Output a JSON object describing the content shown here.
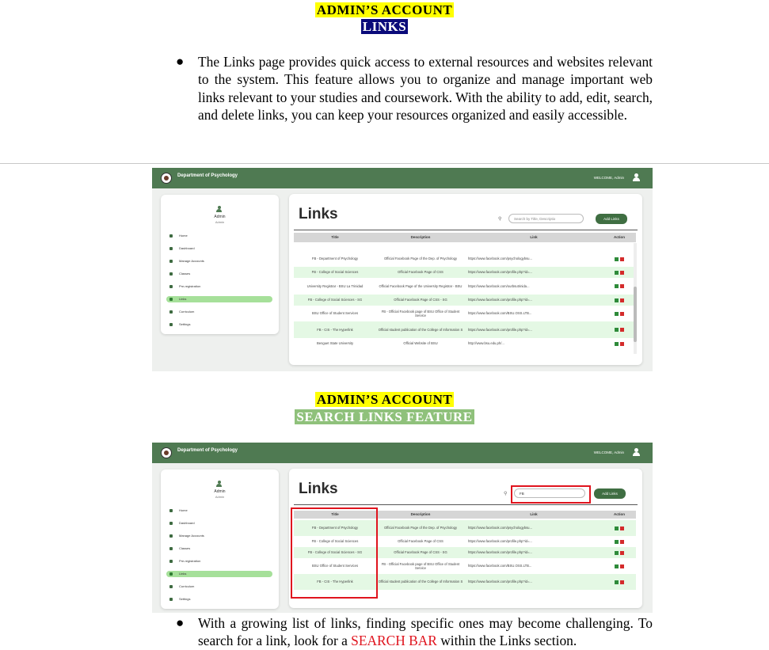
{
  "section1": {
    "heading1": "ADMIN’S ACCOUNT",
    "heading2": "LINKS",
    "bullet": "●",
    "paragraph": "The Links page provides quick access to external resources and websites relevant to the system. This feature allows you to organize and manage important web links relevant to your studies and coursework. With the ability to add, edit, search, and delete links, you can keep your resources organized and easily accessible."
  },
  "section2": {
    "heading1": "ADMIN’S ACCOUNT",
    "heading2": "SEARCH LINKS FEATURE",
    "bullet": "●",
    "paragraph_before": "With a growing list of links, finding specific ones may become challenging. To search for a link, look for a ",
    "paragraph_highlight": "SEARCH BAR",
    "paragraph_after": " within the Links section."
  },
  "app": {
    "department": "Department of Psychology",
    "welcome": "WELCOME, Admin",
    "user_name": "Admin",
    "user_role": "Admin",
    "nav": [
      "Home",
      "Dashboard",
      "Manage Accounts",
      "Classes",
      "Pre-registration",
      "Links",
      "Curriculum",
      "Settings"
    ],
    "page_title": "Links",
    "search_placeholder": "Search by Title, Descriptio",
    "search_value": "FB",
    "add_button": "Add Links",
    "columns": [
      "Title",
      "Description",
      "Link",
      "Action"
    ],
    "accent_color": "#4f7a52",
    "highlight_row_color": "#e4f8e4",
    "rows_full": [
      {
        "title": "FB - Department of Psychology",
        "description": "Official Facebook Page of the Dep. of Psychology",
        "link": "https://www.facebook.com/psychologybsu..."
      },
      {
        "title": "FB - College of Social Sciences",
        "description": "Official Facebook Page of CSS",
        "link": "https://www.facebook.com/profile.php?id=..."
      },
      {
        "title": "University Registrar - BSU La Trinidad",
        "description": "Official Facebook Page of the University Registrar - BSU",
        "link": "https://www.facebook.com/ourbsutrinida..."
      },
      {
        "title": "FB - College of Social Sciences - SG",
        "description": "Official Facebook Page of CSS - SG",
        "link": "https://www.facebook.com/profile.php?id=..."
      },
      {
        "title": "BSU Office of Student Services",
        "description": "FB - Official Facebook page of BSU Office of Student Service",
        "link": "https://www.facebook.com/BSU.OSS.LTB..."
      },
      {
        "title": "FB - CIS - The Hyperlink",
        "description": "Official student publication of the College of Information S",
        "link": "https://www.facebook.com/profile.php?id=..."
      },
      {
        "title": "Benguet State University",
        "description": "Official Website of BSU",
        "link": "http://www.bsu.edu.ph/..."
      }
    ],
    "rows_search": [
      {
        "title": "FB - Department of Psychology",
        "description": "Official Facebook Page of the Dep. of Psychology",
        "link": "https://www.facebook.com/psychologybsu..."
      },
      {
        "title": "FB - College of Social Sciences",
        "description": "Official Facebook Page of CSS",
        "link": "https://www.facebook.com/profile.php?id=..."
      },
      {
        "title": "FB - College of Social Sciences - SG",
        "description": "Official Facebook Page of CSS - SG",
        "link": "https://www.facebook.com/profile.php?id=..."
      },
      {
        "title": "BSU Office of Student Services",
        "description": "FB - Official Facebook page of BSU Office of Student Service",
        "link": "https://www.facebook.com/BSU.OSS.LTB..."
      },
      {
        "title": "FB - CIS - The Hyperlink",
        "description": "Official student publication of the College of Information S",
        "link": "https://www.facebook.com/profile.php?id=..."
      }
    ]
  }
}
